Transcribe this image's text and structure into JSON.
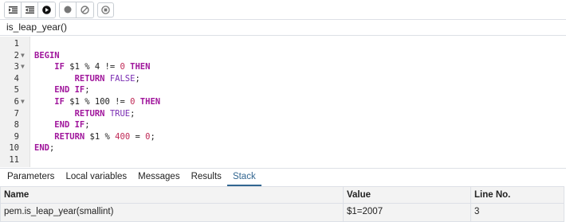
{
  "toolbar": {
    "buttons": [
      {
        "icon": "step-into-icon"
      },
      {
        "icon": "step-over-icon"
      },
      {
        "icon": "continue-icon"
      },
      {
        "icon": "toggle-breakpoint-icon"
      },
      {
        "icon": "clear-breakpoints-icon"
      },
      {
        "icon": "stop-icon"
      }
    ]
  },
  "function_title": "is_leap_year()",
  "editor": {
    "lines": [
      {
        "n": "1",
        "fold": ""
      },
      {
        "n": "2",
        "fold": "▼"
      },
      {
        "n": "3",
        "fold": "▼"
      },
      {
        "n": "4",
        "fold": ""
      },
      {
        "n": "5",
        "fold": ""
      },
      {
        "n": "6",
        "fold": "▼"
      },
      {
        "n": "7",
        "fold": ""
      },
      {
        "n": "8",
        "fold": ""
      },
      {
        "n": "9",
        "fold": ""
      },
      {
        "n": "10",
        "fold": ""
      },
      {
        "n": "11",
        "fold": ""
      }
    ],
    "code": {
      "l2_kw": "BEGIN",
      "l3_if": "IF",
      "l3_expr": " $1 % 4 != ",
      "l3_num": "0",
      "l3_then": "THEN",
      "l4_return": "RETURN",
      "l4_val": "FALSE",
      "l4_end": ";",
      "l5_end": "END IF",
      "l5_semi": ";",
      "l6_if": "IF",
      "l6_expr": " $1 % 100 != ",
      "l6_num": "0",
      "l6_then": "THEN",
      "l7_return": "RETURN",
      "l7_val": "TRUE",
      "l7_end": ";",
      "l8_end": "END IF",
      "l8_semi": ";",
      "l9_return": "RETURN",
      "l9_expr": " $1 % ",
      "l9_num1": "400",
      "l9_eq": " = ",
      "l9_num2": "0",
      "l9_semi": ";",
      "l10_end": "END",
      "l10_semi": ";"
    }
  },
  "tabs": [
    "Parameters",
    "Local variables",
    "Messages",
    "Results",
    "Stack"
  ],
  "active_tab": "Stack",
  "stack": {
    "columns": [
      "Name",
      "Value",
      "Line No."
    ],
    "rows": [
      [
        "pem.is_leap_year(smallint)",
        "$1=2007",
        "3"
      ]
    ]
  }
}
